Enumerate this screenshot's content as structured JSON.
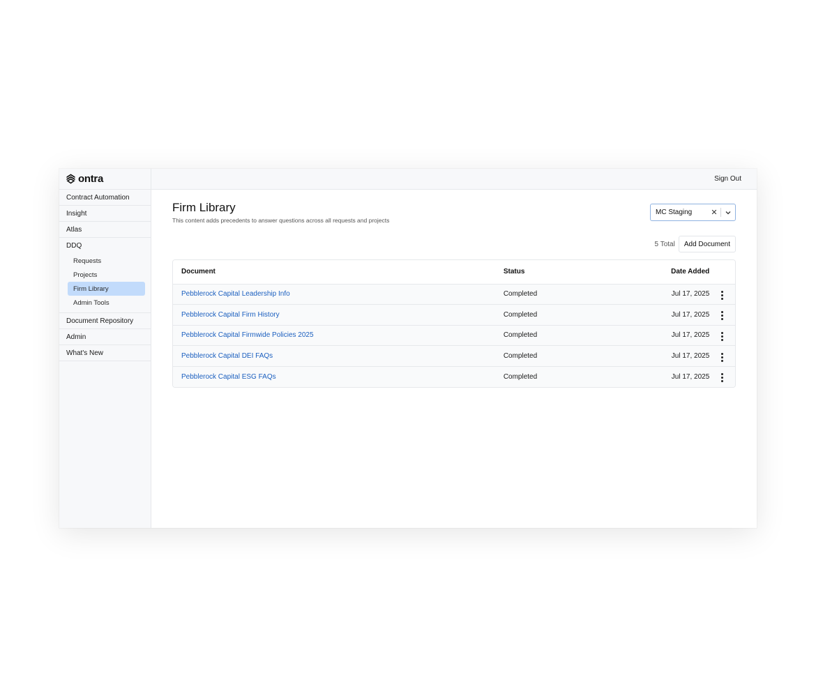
{
  "brand": {
    "name": "ontra"
  },
  "sidebar": {
    "items": [
      {
        "label": "Contract Automation"
      },
      {
        "label": "Insight"
      },
      {
        "label": "Atlas"
      }
    ],
    "ddq": {
      "label": "DDQ",
      "children": [
        {
          "label": "Requests"
        },
        {
          "label": "Projects"
        },
        {
          "label": "Firm Library",
          "active": true
        },
        {
          "label": "Admin Tools"
        }
      ]
    },
    "items_after": [
      {
        "label": "Document Repository"
      },
      {
        "label": "Admin"
      },
      {
        "label": "What's New"
      }
    ]
  },
  "header": {
    "sign_out": "Sign Out"
  },
  "page": {
    "title": "Firm Library",
    "subtitle": "This content adds precedents to answer questions across all requests and projects"
  },
  "org_select": {
    "value": "MC Staging",
    "clear_glyph": "✕",
    "chevron_glyph": "⌄"
  },
  "toolbar": {
    "total": "5 Total",
    "add_label": "Add Document"
  },
  "table": {
    "columns": {
      "document": "Document",
      "status": "Status",
      "date": "Date Added"
    },
    "rows": [
      {
        "document": "Pebblerock Capital Leadership Info",
        "status": "Completed",
        "date": "Jul 17, 2025"
      },
      {
        "document": "Pebblerock Capital Firm History",
        "status": "Completed",
        "date": "Jul 17, 2025"
      },
      {
        "document": "Pebblerock Capital Firmwide Policies 2025",
        "status": "Completed",
        "date": "Jul 17, 2025"
      },
      {
        "document": "Pebblerock Capital DEI FAQs",
        "status": "Completed",
        "date": "Jul 17, 2025"
      },
      {
        "document": "Pebblerock Capital ESG FAQs",
        "status": "Completed",
        "date": "Jul 17, 2025"
      }
    ]
  },
  "colors": {
    "accent": "#1b5fbf",
    "active_nav": "#c2dbfb",
    "sidebar_bg": "#f7f8fa"
  },
  "icons": {
    "logo": "ontra-logo-icon",
    "clear": "close-icon",
    "chevron": "chevron-down-icon",
    "row_menu": "more-vertical-icon"
  }
}
